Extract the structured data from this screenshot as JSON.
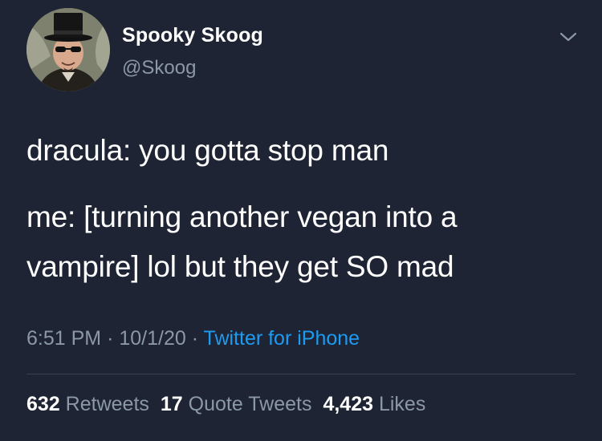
{
  "author": {
    "display_name": "Spooky Skoog",
    "handle": "@Skoog",
    "avatar_icon": "avatar-man-top-hat"
  },
  "menu": {
    "icon": "chevron-down-icon"
  },
  "tweet": {
    "lines": [
      "dracula: you gotta stop man",
      "me: [turning another vegan into a",
      "vampire] lol but they get SO mad"
    ]
  },
  "meta": {
    "time": "6:51 PM",
    "separator": "·",
    "date": "10/1/20",
    "source": "Twitter for iPhone"
  },
  "stats": {
    "retweets_count": "632",
    "retweets_label": "Retweets",
    "quotes_count": "17",
    "quotes_label": "Quote Tweets",
    "likes_count": "4,423",
    "likes_label": "Likes"
  },
  "colors": {
    "background": "#1e2433",
    "primary_text": "#ffffff",
    "secondary_text": "#8b98a5",
    "link": "#1d9bf0"
  }
}
